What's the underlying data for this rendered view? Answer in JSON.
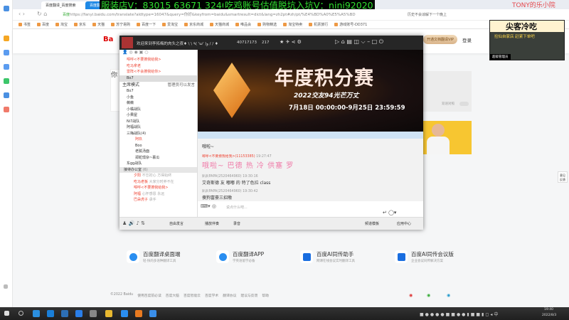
{
  "overlay": {
    "banner_left": "服装店V：83015 63671 32406",
    "banner_right": "吃鸡账号估值脱坑入坑V：nini92020",
    "streamer_name": "TONY的乐小院",
    "cam_title": "尖客冷吃",
    "cam_subtitle": "捡仙自家店 赶紧下单吧",
    "cam_badge": "超级管理员"
  },
  "browser": {
    "tabs": [
      "百度翻译_百度搜索",
      "百度翻"
    ],
    "url": "https://fanyi.baidu.com/translate?aldtype=16047&query=你好&keyfrom=baidu&smartresult=dict&lang=zh2pt#zh/pt/%E4%BD%A0%E5%A5%BD",
    "site_badge": "百度",
    "search_hint": "历史不会谅解下一个晚上",
    "bookmarks": [
      "书签",
      "百度",
      "淘宝",
      "京东",
      "天猫",
      "苏宁易购",
      "百度一下",
      "爱淘宝",
      "京东商城",
      "天猫商城",
      "唯品会",
      "购物精选",
      "淘宝特卖",
      "机票旅行",
      "游戏账号-DD371"
    ]
  },
  "page": {
    "logo": "Ba",
    "vip_button": "开通文档翻译VIP",
    "login": "登录",
    "input_preview": "你",
    "toggle_label": "双语对照",
    "products": [
      {
        "title": "百度翻译桌面端",
        "desc": "轻·快的多语种翻译工具"
      },
      {
        "title": "百度翻译APP",
        "desc": "学英语留学必备"
      },
      {
        "title": "百度AI同传助手",
        "desc": "网课在线会议实时翻译工具"
      },
      {
        "title": "百度AI同传会议版",
        "desc": "企业会议同传解决方案"
      }
    ],
    "footer": [
      "©2022 Baidu",
      "使用百度前必读",
      "百度大脑",
      "百度智能云",
      "百度学术",
      "翻译协议",
      "建议与反馈",
      "帮助"
    ],
    "side_float": "意见反馈"
  },
  "yy": {
    "channel_title": "欢迎来到李拓梅的肉头之夜♦ \\ \\ ٩( 'ω' )و / / ♦",
    "channel_id": "40717173",
    "online": "217",
    "top_members": [
      "嘚呼<不要撩我给我>",
      "吃马拿老",
      "雷阵<不会撩我给你>",
      "Bo7"
    ],
    "mode": "主席模式",
    "mode_hint": "管理员可以发言",
    "groups": [
      "Bo7",
      "小鱼",
      "薇薇",
      "小橘战队",
      "小果屋",
      "Ni7战队",
      "阿福战队",
      "三梅战队(4)"
    ],
    "sub_members": [
      "阿玖",
      "Boo",
      "老腻汤面",
      "郑蛇璟杂~慕瓜"
    ],
    "group_tail": "东gg战队",
    "office": "接待办公室",
    "office_count": "(6)",
    "office_members": [
      {
        "name": "夕阳",
        "note": "不忘初心 方得始终"
      },
      {
        "name": "吃马老板",
        "note": "大家分时养不在"
      },
      {
        "name": "嘚呼<不要撩我给我>",
        "note": ""
      },
      {
        "name": "阿福",
        "note": "心怀感恩 永远"
      },
      {
        "name": "巴朵虎子",
        "note": "承手"
      }
    ],
    "bottom_left": [
      "自由发言"
    ],
    "banner": {
      "title": "年度积分赛",
      "sub": "2022交友94光芒万丈",
      "date": "7月18日 00:00:00-9月25日 23:59:59"
    },
    "chat": [
      {
        "type": "plain",
        "text": "哦啦~"
      },
      {
        "type": "big",
        "user": "嘚呼<不要撩我给我>(11153385)",
        "time": "19:27:47",
        "text": "哦啦~ 巴德 热 冷 供塞 罗"
      },
      {
        "type": "msg",
        "user": "趴趴PAPA(2520464960)",
        "time": "19:30:16",
        "text": "艾奇斯德 友 嘟嘟 的 特了色拉 class"
      },
      {
        "type": "msg",
        "user": "趴趴PAPA(2520464960)",
        "time": "19:30:42",
        "text": "傻狗富豪三招嗷"
      }
    ],
    "input_placeholder": "说点什么吧...",
    "toolbar": [
      "播放伴奏",
      "录音",
      "频道模板",
      "应用中心"
    ]
  },
  "taskbar": {
    "time": "19:40",
    "date": "2022/8/3"
  }
}
